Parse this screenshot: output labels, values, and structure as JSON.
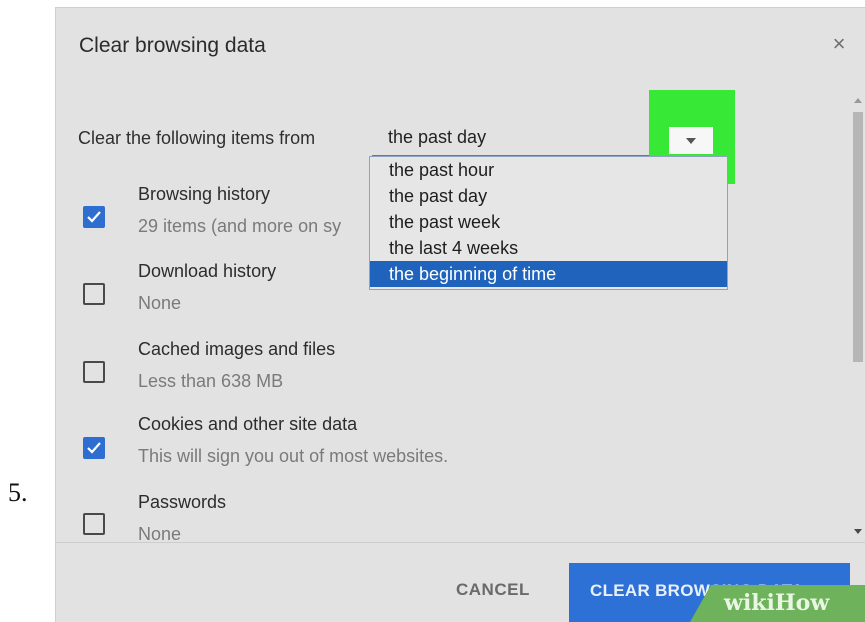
{
  "step_number": "5.",
  "dialog": {
    "title": "Clear browsing data",
    "close_label": "×"
  },
  "time_range": {
    "label": "Clear the following items from",
    "selected": "the past day",
    "options": [
      {
        "label": "the past hour",
        "highlighted": false
      },
      {
        "label": "the past day",
        "highlighted": false
      },
      {
        "label": "the past week",
        "highlighted": false
      },
      {
        "label": "the last 4 weeks",
        "highlighted": false
      },
      {
        "label": "the beginning of time",
        "highlighted": true
      }
    ],
    "dropdown_highlight_color": "#37e837"
  },
  "items": [
    {
      "label": "Browsing history",
      "sub": "29 items (and more on sy",
      "checked": true
    },
    {
      "label": "Download history",
      "sub": "None",
      "checked": false
    },
    {
      "label": "Cached images and files",
      "sub": "Less than 638 MB",
      "checked": false
    },
    {
      "label": "Cookies and other site data",
      "sub": "This will sign you out of most websites.",
      "checked": true
    },
    {
      "label": "Passwords",
      "sub": "None",
      "checked": false
    }
  ],
  "buttons": {
    "cancel": "CANCEL",
    "clear": "CLEAR BROWSING DATA"
  },
  "watermark": "wikiHow",
  "colors": {
    "accent": "#2d70d6",
    "selected_option": "#1f63bd",
    "dialog_bg": "#e2e2e2"
  }
}
